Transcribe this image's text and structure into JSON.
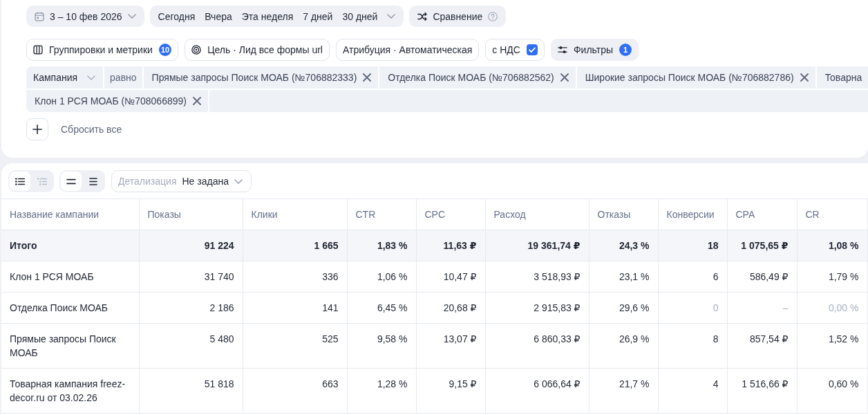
{
  "date_range": {
    "label": "3 – 10 фев 2026"
  },
  "presets": [
    "Сегодня",
    "Вчера",
    "Эта неделя",
    "7 дней",
    "30 дней"
  ],
  "comparison": {
    "label": "Сравнение"
  },
  "settings": {
    "groupings": {
      "label": "Группировки и метрики",
      "badge": "10"
    },
    "goal": {
      "label": "Цель · Лид все формы url"
    },
    "attribution": {
      "label": "Атрибуция · Автоматическая"
    },
    "vat": {
      "label": "с НДС",
      "checked": true
    },
    "filters": {
      "label": "Фильтры",
      "badge": "1",
      "active": true
    }
  },
  "filter": {
    "field": "Кампания",
    "operator": "равно",
    "values": [
      {
        "label": "Прямые запросы Поиск МОАБ (№706882333)",
        "clipped": false
      },
      {
        "label": "Отделка Поиск МОАБ (№706882562)",
        "clipped": false
      },
      {
        "label": "Широкие запросы Поиск МОАБ (№706882786)",
        "clipped": false
      },
      {
        "label": "Товарна",
        "clipped": true
      },
      {
        "label": "Клон 1 РСЯ МОАБ (№708066899)",
        "clipped": false
      }
    ]
  },
  "reset": {
    "label": "Сбросить все"
  },
  "view": {
    "layouts": [
      {
        "kind": "flat",
        "selected": true
      },
      {
        "kind": "tree",
        "selected": false
      }
    ],
    "density": [
      {
        "kind": "compact",
        "selected": true
      },
      {
        "kind": "regular",
        "selected": false
      }
    ],
    "detail": {
      "label": "Детализация",
      "value": "Не задана"
    }
  },
  "table": {
    "columns": [
      "Название кампании",
      "Показы",
      "Клики",
      "CTR",
      "CPC",
      "Расход",
      "Отказы",
      "Конверсии",
      "CPA",
      "CR"
    ],
    "rows": [
      {
        "kind": "total",
        "cells": [
          {
            "text": "Итого",
            "muted": false
          },
          {
            "text": "91 224",
            "muted": false
          },
          {
            "text": "1 665",
            "muted": false
          },
          {
            "text": "1,83 %",
            "muted": false
          },
          {
            "text": "11,63 ₽",
            "muted": false
          },
          {
            "text": "19 361,74 ₽",
            "muted": false
          },
          {
            "text": "24,3 %",
            "muted": false
          },
          {
            "text": "18",
            "muted": false
          },
          {
            "text": "1 075,65 ₽",
            "muted": false
          },
          {
            "text": "1,08 %",
            "muted": false
          }
        ]
      },
      {
        "kind": "campaign",
        "cells": [
          {
            "text": "Клон 1 РСЯ МОАБ",
            "muted": false
          },
          {
            "text": "31 740",
            "muted": false
          },
          {
            "text": "336",
            "muted": false
          },
          {
            "text": "1,06 %",
            "muted": false
          },
          {
            "text": "10,47 ₽",
            "muted": false
          },
          {
            "text": "3 518,93 ₽",
            "muted": false
          },
          {
            "text": "23,1 %",
            "muted": false
          },
          {
            "text": "6",
            "muted": false
          },
          {
            "text": "586,49 ₽",
            "muted": false
          },
          {
            "text": "1,79 %",
            "muted": false
          }
        ]
      },
      {
        "kind": "campaign",
        "cells": [
          {
            "text": "Отделка Поиск МОАБ",
            "muted": false
          },
          {
            "text": "2 186",
            "muted": false
          },
          {
            "text": "141",
            "muted": false
          },
          {
            "text": "6,45 %",
            "muted": false
          },
          {
            "text": "20,68 ₽",
            "muted": false
          },
          {
            "text": "2 915,83 ₽",
            "muted": false
          },
          {
            "text": "29,6 %",
            "muted": false
          },
          {
            "text": "0",
            "muted": true
          },
          {
            "text": "–",
            "muted": true
          },
          {
            "text": "0,00 %",
            "muted": true
          }
        ]
      },
      {
        "kind": "campaign",
        "cells": [
          {
            "text": "Прямые запросы Поиск МОАБ",
            "muted": false
          },
          {
            "text": "5 480",
            "muted": false
          },
          {
            "text": "525",
            "muted": false
          },
          {
            "text": "9,58 %",
            "muted": false
          },
          {
            "text": "13,07 ₽",
            "muted": false
          },
          {
            "text": "6 860,33 ₽",
            "muted": false
          },
          {
            "text": "26,9 %",
            "muted": false
          },
          {
            "text": "8",
            "muted": false
          },
          {
            "text": "857,54 ₽",
            "muted": false
          },
          {
            "text": "1,52 %",
            "muted": false
          }
        ]
      },
      {
        "kind": "campaign",
        "cells": [
          {
            "text": "Товарная кампания freez-decor.ru от 03.02.26",
            "muted": false
          },
          {
            "text": "51 818",
            "muted": false
          },
          {
            "text": "663",
            "muted": false
          },
          {
            "text": "1,28 %",
            "muted": false
          },
          {
            "text": "9,15 ₽",
            "muted": false
          },
          {
            "text": "6 066,64 ₽",
            "muted": false
          },
          {
            "text": "21,7 %",
            "muted": false
          },
          {
            "text": "4",
            "muted": false
          },
          {
            "text": "1 516,66 ₽",
            "muted": false
          },
          {
            "text": "0,60 %",
            "muted": false
          }
        ]
      }
    ]
  }
}
